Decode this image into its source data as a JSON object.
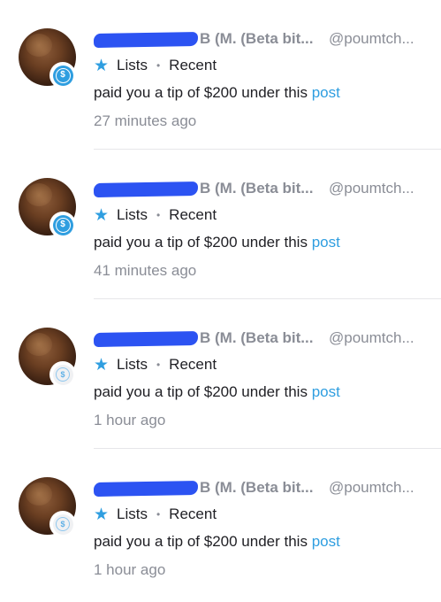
{
  "notifications": [
    {
      "name_suffix": "B (M. (Beta bit...",
      "handle": "@poumtch...",
      "lists_label": "Lists",
      "recent_label": "Recent",
      "message": "paid you a tip of $200 under this ",
      "link_text": "post",
      "time": "27 minutes ago",
      "badge_state": "unread"
    },
    {
      "name_suffix": "B (M. (Beta bit...",
      "handle": "@poumtch...",
      "lists_label": "Lists",
      "recent_label": "Recent",
      "message": "paid you a tip of $200 under this ",
      "link_text": "post",
      "time": "41 minutes ago",
      "badge_state": "unread"
    },
    {
      "name_suffix": "B (M. (Beta bit...",
      "handle": "@poumtch...",
      "lists_label": "Lists",
      "recent_label": "Recent",
      "message": "paid you a tip of $200 under this ",
      "link_text": "post",
      "time": "1 hour ago",
      "badge_state": "read"
    },
    {
      "name_suffix": "B (M. (Beta bit...",
      "handle": "@poumtch...",
      "lists_label": "Lists",
      "recent_label": "Recent",
      "message": "paid you a tip of $200 under this ",
      "link_text": "post",
      "time": "1 hour ago",
      "badge_state": "read"
    }
  ],
  "icons": {
    "badge": "dollar-coin-icon",
    "lists": "star-icon",
    "separator": "bullet"
  },
  "colors": {
    "accent": "#2f9ee0",
    "redaction": "#2c53f2",
    "muted_text": "#8a8d96"
  },
  "glyphs": {
    "dollar": "$",
    "star": "★",
    "bullet": "•"
  }
}
